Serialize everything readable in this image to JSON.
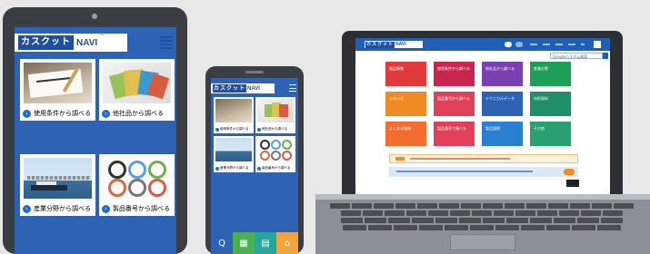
{
  "brand": {
    "name_jp": "カスクット",
    "name_navi": "NAVI",
    "tm": "™"
  },
  "tablet": {
    "cards": [
      {
        "label": "使用条件から調べる",
        "image": "hand-writing-photo"
      },
      {
        "label": "他社品から調べる",
        "image": "gasket-samples-photo"
      },
      {
        "label": "産業分野から調べる",
        "image": "port-ship-photo"
      },
      {
        "label": "製品番号から調べる",
        "image": "rings-photo"
      }
    ]
  },
  "phone": {
    "tabs": [
      {
        "icon": "search-icon",
        "glyph": "Q",
        "color": "#2d62b4"
      },
      {
        "icon": "calculator-icon",
        "glyph": "▦",
        "color": "#4caf50"
      },
      {
        "icon": "document-icon",
        "glyph": "▤",
        "color": "#26a69a"
      },
      {
        "icon": "home-icon",
        "glyph": "⌂",
        "color": "#f2a33a"
      }
    ]
  },
  "laptop": {
    "search_placeholder": "Googleカスタム検索",
    "tiles": [
      {
        "label": "製品情報",
        "color": "#e23a3a"
      },
      {
        "label": "使用条件から調べる",
        "color": "#c8264f"
      },
      {
        "label": "他社品から調べる",
        "color": "#7a3fb0"
      },
      {
        "label": "産業分野",
        "color": "#1f9e5a"
      },
      {
        "label": "カタログ",
        "color": "#f08a24"
      },
      {
        "label": "製品番号から調べる",
        "color": "#e2405a"
      },
      {
        "label": "テクニカルデータ",
        "color": "#2d62b4"
      },
      {
        "label": "技術資料",
        "color": "#1f8f6a"
      },
      {
        "label": "よくある質問",
        "color": "#f26d2e"
      },
      {
        "label": "製品番号で調べる",
        "color": "#e2405a"
      },
      {
        "label": "製品説明",
        "color": "#2a7fd0"
      },
      {
        "label": "その他",
        "color": "#28a070"
      }
    ]
  },
  "colors": {
    "app_blue": "#2d62b4",
    "brand_blue": "#1f4fa0"
  }
}
